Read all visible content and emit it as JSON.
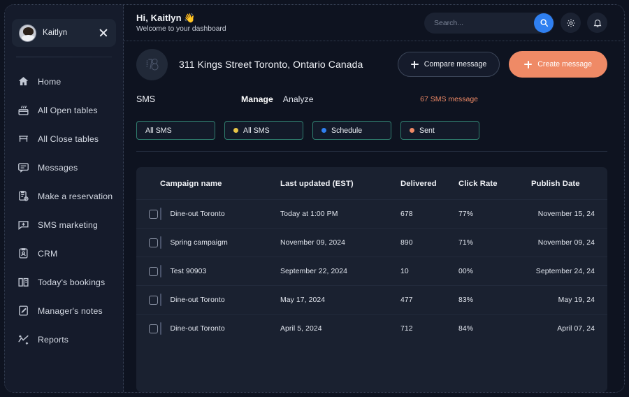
{
  "sidebar": {
    "profile": {
      "name": "Kaitlyn",
      "close_icon": "close-icon",
      "avatar_icon": "avatar"
    },
    "items": [
      {
        "label": "Home",
        "icon": "home-icon"
      },
      {
        "label": "All Open tables",
        "icon": "open-tables-icon"
      },
      {
        "label": "All Close tables",
        "icon": "close-tables-icon"
      },
      {
        "label": "Messages",
        "icon": "messages-icon"
      },
      {
        "label": "Make a reservation",
        "icon": "reservation-icon"
      },
      {
        "label": "SMS marketing",
        "icon": "sms-marketing-icon"
      },
      {
        "label": "CRM",
        "icon": "crm-icon"
      },
      {
        "label": "Today's bookings",
        "icon": "bookings-icon"
      },
      {
        "label": "Manager's notes",
        "icon": "notes-icon"
      },
      {
        "label": "Reports",
        "icon": "reports-icon"
      }
    ]
  },
  "topbar": {
    "greeting": "Hi, Kaitlyn 👋",
    "subtitle": "Welcome to your dashboard",
    "search": {
      "value": "",
      "placeholder": "Search...",
      "icon": "search-icon"
    },
    "settings_icon": "gear-icon",
    "notifications_icon": "bell-icon"
  },
  "venue": {
    "logo_text": "78",
    "address": "311 Kings Street Toronto, Ontario Canada",
    "compare_label": "Compare message",
    "create_label": "Create message"
  },
  "section": {
    "title": "SMS",
    "tabs": [
      {
        "label": "Manage",
        "active": true
      },
      {
        "label": "Analyze",
        "active": false
      }
    ],
    "count_text": "67 SMS message"
  },
  "filters": [
    {
      "label": "All SMS",
      "dot": ""
    },
    {
      "label": "All SMS",
      "dot": "#e8c547"
    },
    {
      "label": "Schedule",
      "dot": "#2f7ff0"
    },
    {
      "label": "Sent",
      "dot": "#ef8a66"
    }
  ],
  "table": {
    "columns": [
      "Campaign name",
      "Last updated (EST)",
      "Delivered",
      "Click Rate",
      "Publish Date"
    ],
    "rows": [
      {
        "name": "Dine-out Toronto",
        "updated": "Today at 1:00 PM",
        "delivered": "678",
        "click_rate": "77%",
        "publish": "November 15, 24"
      },
      {
        "name": "Spring campaigm",
        "updated": "November 09, 2024",
        "delivered": "890",
        "click_rate": "71%",
        "publish": "November 09, 24"
      },
      {
        "name": "Test 90903",
        "updated": "September 22, 2024",
        "delivered": "10",
        "click_rate": "00%",
        "publish": "September 24, 24"
      },
      {
        "name": "Dine-out Toronto",
        "updated": "May 17, 2024",
        "delivered": "477",
        "click_rate": "83%",
        "publish": "May 19, 24"
      },
      {
        "name": "Dine-out Toronto",
        "updated": "April 5, 2024",
        "delivered": "712",
        "click_rate": "84%",
        "publish": "April 07, 24"
      }
    ]
  },
  "colors": {
    "accent": "#ef8a66",
    "primary_blue": "#2f7ff0",
    "chip_border": "#2f7d6e",
    "sidebar_bg": "#151b2b",
    "page_bg": "#0e1320",
    "card_bg": "#1a2130"
  }
}
